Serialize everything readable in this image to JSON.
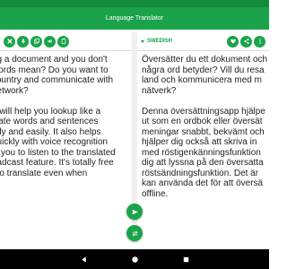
{
  "app": {
    "title": "Language Translator"
  },
  "colors": {
    "accent": "#1aa34a",
    "statusbar": "#148a3c",
    "navbar": "#000000"
  },
  "source": {
    "toolbar_icons": [
      "close-icon",
      "mic-icon",
      "copy-icon",
      "speaker-icon",
      "clipboard-icon"
    ],
    "text": "ng a document and you don't\nwords mean? Do you want to\ncountry and communicate with\nnetwork?\n\np will help you lookup like a\nslate words and sentences\nntly and easily. It also helps\nquickly with voice recognition\nw you to listen to the translated\nbadcast feature. It's totally free\nt to translate even when"
  },
  "target": {
    "language": "SWEDISH",
    "toolbar_icons": [
      "favorite-icon",
      "share-icon",
      "more-icon"
    ],
    "text": "Översätter du ett dokument och\nnågra ord betyder? Vill du resa\nland och kommunicera med m\nnätverk?\n\nDenna översättningsapp hjälpe\nut som en ordbok eller översät\nmeningar snabbt, bekvämt och\nhjälper dig också att skriva in\nmed röstigenkänningsfunktion\ndig att lyssna på den översatta\nröstsändningsfunktion. Det är\nkan använda det för att översä\noffline."
  },
  "fabs": [
    "send-icon",
    "swap-icon"
  ],
  "navigation": [
    "back-icon",
    "home-icon",
    "recents-icon"
  ]
}
